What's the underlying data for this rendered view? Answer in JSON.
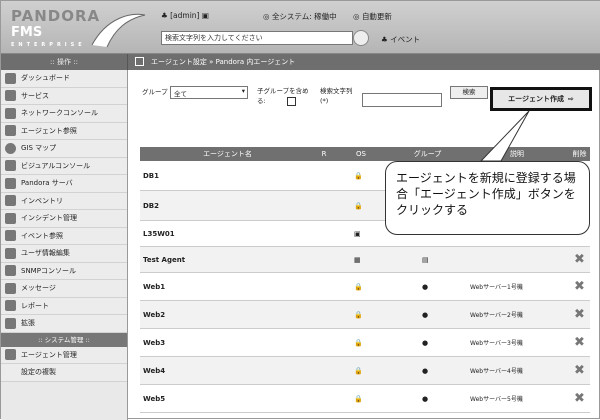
{
  "header": {
    "logo_line1": "PANDORA",
    "logo_line2": "FMS",
    "logo_line3": "ENTERPRISE",
    "user": "[admin]",
    "status": "全システム: 稼働中",
    "autorefresh": "自動更新",
    "search_placeholder": "検索文字列を入力してください",
    "events": "イベント"
  },
  "nav": {
    "menu_title": ":: 操作 ::",
    "breadcrumb": "エージェント設定 » Pandora 内エージェント"
  },
  "sidebar": {
    "items": [
      "ダッシュボード",
      "サービス",
      "ネットワークコンソール",
      "エージェント参照",
      "GIS マップ",
      "ビジュアルコンソール",
      "Pandora サーバ",
      "インベントリ",
      "インシデント管理",
      "イベント参照",
      "ユーザ情報編集",
      "SNMPコンソール",
      "メッセージ",
      "レポート",
      "拡張"
    ],
    "section": ":: システム管理 ::",
    "section_items": [
      "エージェント管理",
      "設定の複製"
    ]
  },
  "filter": {
    "group_label": "グループ",
    "group_value": "全て",
    "subgroup_label": "子グループを含める:",
    "search_label": "検索文字列 (*)",
    "search_button": "検索",
    "create_button": "エージェント作成"
  },
  "table": {
    "headers": [
      "エージェント名",
      "R",
      "OS",
      "グループ",
      "説明",
      "削除"
    ],
    "rows": [
      {
        "name": "DB1",
        "desc": ""
      },
      {
        "name": "DB2",
        "desc": ""
      },
      {
        "name": "L35W01",
        "desc": ""
      },
      {
        "name": "Test Agent",
        "desc": ""
      },
      {
        "name": "Web1",
        "desc": "Webサーバー1号機"
      },
      {
        "name": "Web2",
        "desc": "Webサーバー2号機"
      },
      {
        "name": "Web3",
        "desc": "Webサーバー3号機"
      },
      {
        "name": "Web4",
        "desc": "Webサーバー4号機"
      },
      {
        "name": "Web5",
        "desc": "Webサーバー5号機"
      }
    ]
  },
  "callout": "エージェントを新規に登録する場合「エージェント作成」ボタンをクリックする"
}
